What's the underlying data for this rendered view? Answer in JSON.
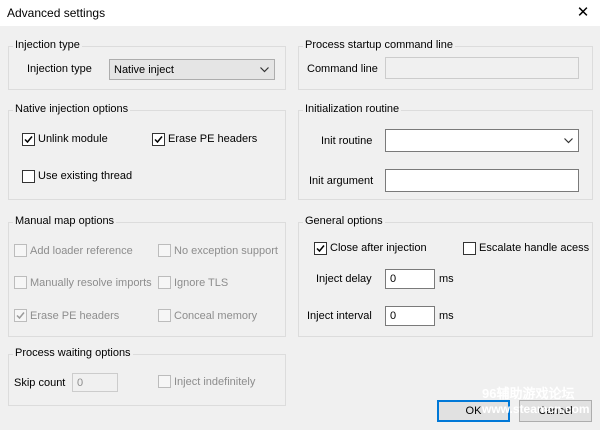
{
  "window": {
    "title": "Advanced settings",
    "close_glyph": "✕"
  },
  "injection_type": {
    "legend": "Injection type",
    "label": "Injection type",
    "selected": "Native inject"
  },
  "native_options": {
    "legend": "Native injection options",
    "unlink_module": {
      "label": "Unlink module",
      "checked": true
    },
    "erase_pe_headers": {
      "label": "Erase PE headers",
      "checked": true
    },
    "use_existing_thread": {
      "label": "Use existing thread",
      "checked": false
    }
  },
  "manual_map": {
    "legend": "Manual map options",
    "add_loader_reference": {
      "label": "Add loader reference",
      "checked": false,
      "enabled": false
    },
    "no_exception_support": {
      "label": "No exception support",
      "checked": false,
      "enabled": false
    },
    "manually_resolve_imports": {
      "label": "Manually resolve imports",
      "checked": false,
      "enabled": false
    },
    "ignore_tls": {
      "label": "Ignore TLS",
      "checked": false,
      "enabled": false
    },
    "erase_pe_headers": {
      "label": "Erase PE headers",
      "checked": true,
      "enabled": false
    },
    "conceal_memory": {
      "label": "Conceal memory",
      "checked": false,
      "enabled": false
    }
  },
  "process_waiting": {
    "legend": "Process waiting options",
    "skip_count_label": "Skip count",
    "skip_count_value": "0",
    "inject_indefinitely": {
      "label": "Inject indefinitely",
      "checked": false,
      "enabled": false
    }
  },
  "startup_cmd": {
    "legend": "Process startup command line",
    "label": "Command line",
    "value": ""
  },
  "init_routine": {
    "legend": "Initialization routine",
    "routine_label": "Init routine",
    "routine_value": "",
    "argument_label": "Init argument",
    "argument_value": ""
  },
  "general": {
    "legend": "General options",
    "close_after_injection": {
      "label": "Close after injection",
      "checked": true
    },
    "escalate_handle_access": {
      "label": "Escalate handle acess",
      "checked": false
    },
    "inject_delay_label": "Inject delay",
    "inject_delay_value": "0",
    "inject_delay_unit": "ms",
    "inject_interval_label": "Inject interval",
    "inject_interval_value": "0",
    "inject_interval_unit": "ms"
  },
  "buttons": {
    "ok": "OK",
    "cancel": "Cancel"
  },
  "watermark": {
    "line1": "96辅助游戏论坛",
    "line2": "www.steamcn.com"
  }
}
